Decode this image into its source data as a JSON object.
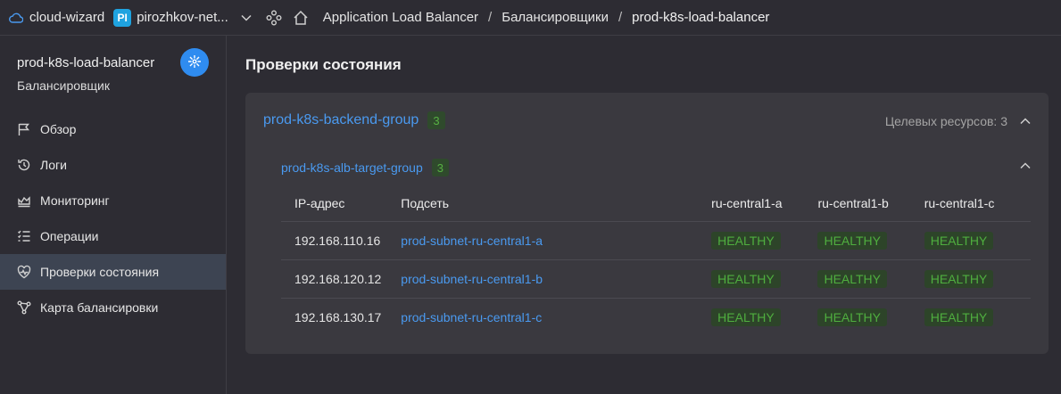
{
  "topbar": {
    "cloud_name": "cloud-wizard",
    "folder_initials": "PI",
    "folder_name": "pirozhkov-net...",
    "breadcrumbs": [
      "Application Load Balancer",
      "Балансировщики",
      "prod-k8s-load-balancer"
    ],
    "separator": "/"
  },
  "sidebar": {
    "title": "prod-k8s-load-balancer",
    "subtitle": "Балансировщик",
    "items": [
      {
        "label": "Обзор",
        "icon": "flag-icon"
      },
      {
        "label": "Логи",
        "icon": "history-icon"
      },
      {
        "label": "Мониторинг",
        "icon": "chart-icon"
      },
      {
        "label": "Операции",
        "icon": "list-icon"
      },
      {
        "label": "Проверки состояния",
        "icon": "heart-pulse-icon",
        "active": true
      },
      {
        "label": "Карта балансировки",
        "icon": "map-icon"
      }
    ]
  },
  "main": {
    "title": "Проверки состояния",
    "backend_group": {
      "name": "prod-k8s-backend-group",
      "count": "3",
      "targets_label": "Целевых ресурсов: 3"
    },
    "target_group": {
      "name": "prod-k8s-alb-target-group",
      "count": "3"
    },
    "table": {
      "headers": [
        "IP-адрес",
        "Подсеть",
        "ru-central1-a",
        "ru-central1-b",
        "ru-central1-c"
      ],
      "rows": [
        {
          "ip": "192.168.110.16",
          "subnet": "prod-subnet-ru-central1-a",
          "a": "HEALTHY",
          "b": "HEALTHY",
          "c": "HEALTHY"
        },
        {
          "ip": "192.168.120.12",
          "subnet": "prod-subnet-ru-central1-b",
          "a": "HEALTHY",
          "b": "HEALTHY",
          "c": "HEALTHY"
        },
        {
          "ip": "192.168.130.17",
          "subnet": "prod-subnet-ru-central1-c",
          "a": "HEALTHY",
          "b": "HEALTHY",
          "c": "HEALTHY"
        }
      ]
    }
  },
  "colors": {
    "accent": "#2f8cf0",
    "link": "#4a9af0",
    "healthy_text": "#4fae3f",
    "healthy_bg": "#2d4429",
    "background": "#2d2c33",
    "card": "#3a393f"
  }
}
